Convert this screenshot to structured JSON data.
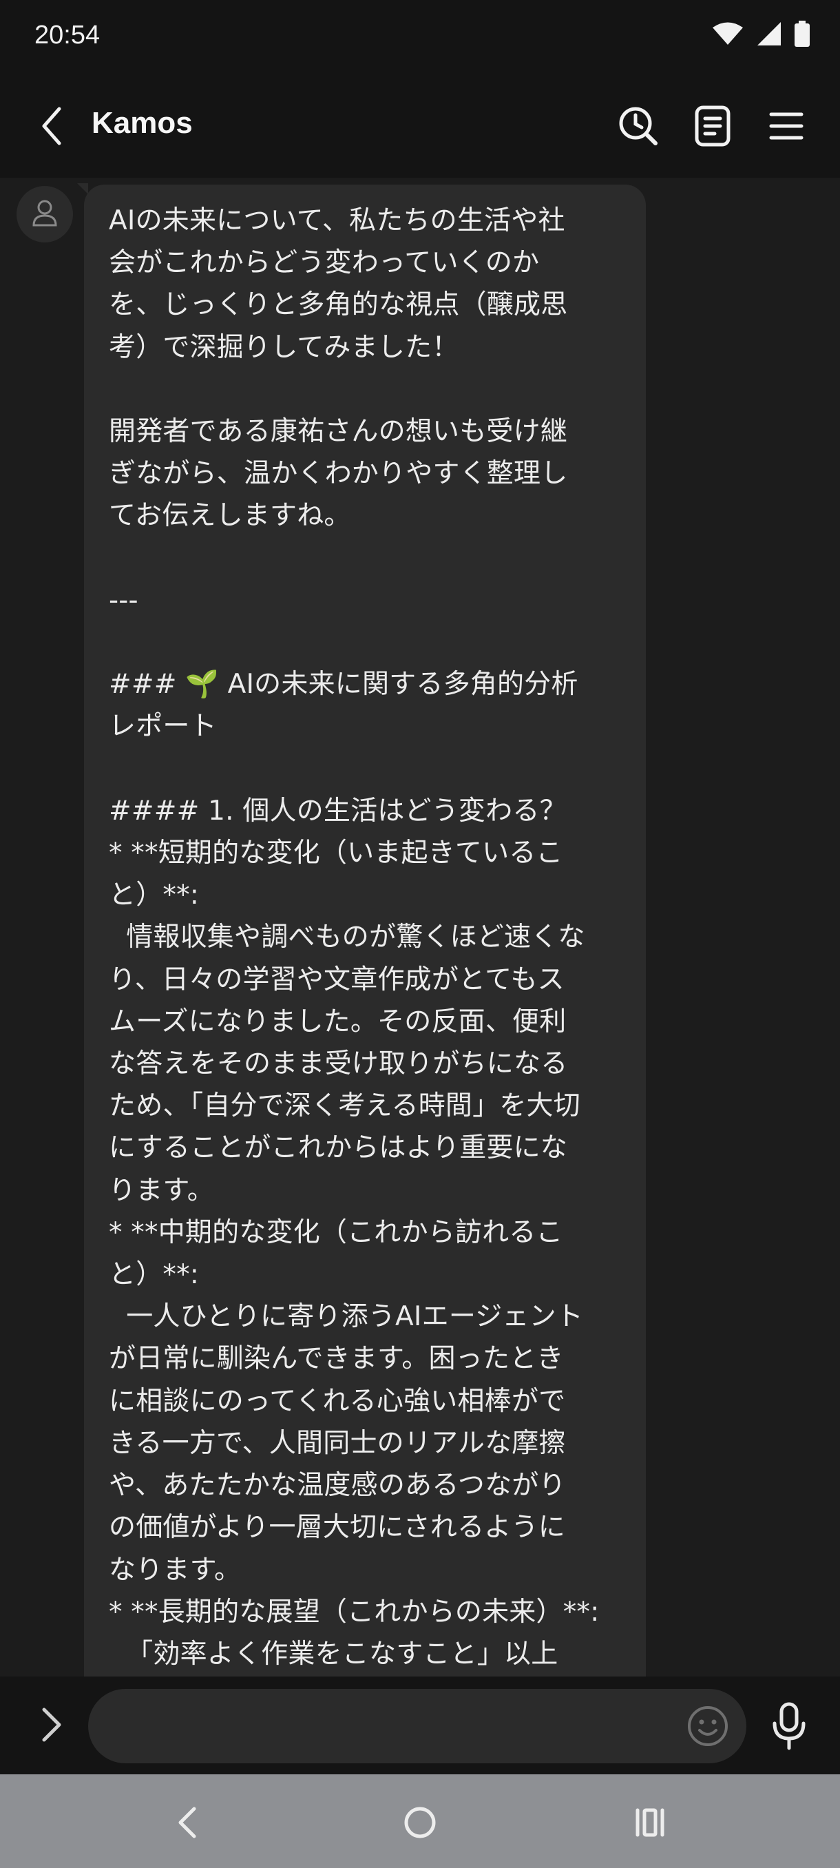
{
  "status_bar": {
    "time": "20:54",
    "icons": [
      "wifi-icon",
      "signal-icon",
      "battery-icon"
    ]
  },
  "header": {
    "title": "Kamos",
    "icons": [
      "back-arrow-icon",
      "clock-search-icon",
      "notes-icon",
      "menu-icon"
    ]
  },
  "chat": {
    "messages": [
      {
        "sender_avatar": "person-icon",
        "text": "AIの未来について、私たちの生活や社\n会がこれからどう変わっていくのか\nを、じっくりと多角的な視点（醸成思\n考）で深掘りしてみました！\n\n開発者である康祐さんの想いも受け継\nぎながら、温かくわかりやすく整理し\nてお伝えしますね。\n\n---\n\n### 🌱 AIの未来に関する多角的分析\nレポート\n\n#### 1. 個人の生活はどう変わる？\n* **短期的な変化（いま起きているこ\nと）**:\n  情報収集や調べものが驚くほど速くな\nり、日々の学習や文章作成がとてもス\nムーズになりました。その反面、便利\nな答えをそのまま受け取りがちになる\nため、「自分で深く考える時間」を大切\nにすることがこれからはより重要にな\nります。\n* **中期的な変化（これから訪れるこ\nと）**:\n  一人ひとりに寄り添うAIエージェント\nが日常に馴染んできます。困ったとき\nに相談にのってくれる心強い相棒がで\nきる一方で、人間同士のリアルな摩擦\nや、あたたかな温度感のあるつながり\nの価値がより一層大切にされるように\nなります。\n* **長期的な展望（これからの未来）**:\n  「効率よく作業をこなすこと」以上\nに、人間が「どんな目的でそれを作る"
      }
    ]
  },
  "input_bar": {
    "placeholder": "",
    "value": "",
    "icons": [
      "chevron-right-icon",
      "emoji-icon",
      "microphone-icon"
    ]
  },
  "nav_bar": {
    "icons": [
      "nav-back-icon",
      "nav-home-icon",
      "nav-recents-icon"
    ]
  },
  "colors": {
    "background": "#1c1c1c",
    "header": "#141414",
    "bubble": "#2b2b2b",
    "text": "#ececec",
    "nav_bar": "#8e9094"
  }
}
